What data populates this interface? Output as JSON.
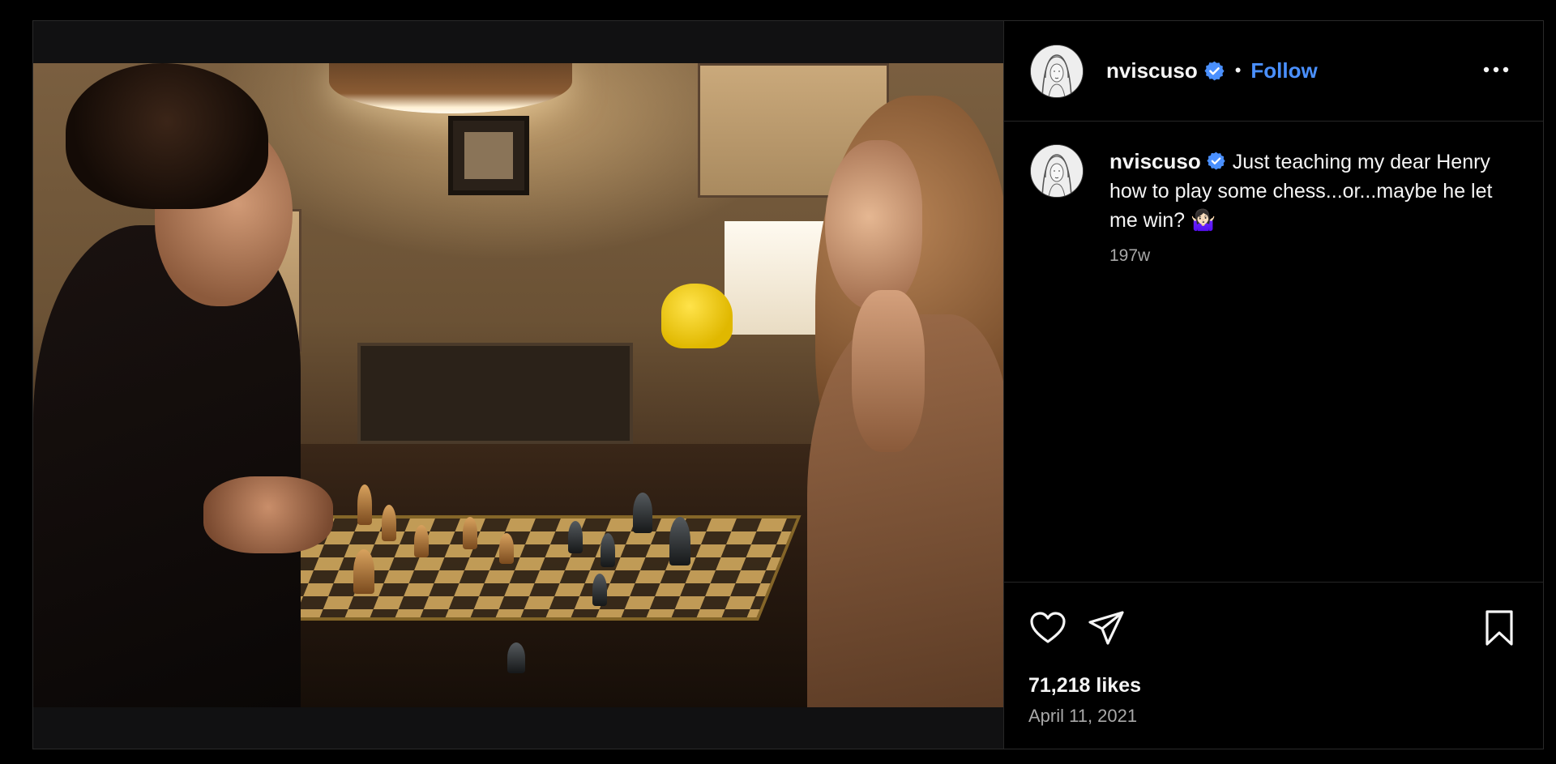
{
  "post": {
    "author": {
      "username": "nviscuso",
      "verified": true,
      "avatar_icon": "avatar-illustration"
    },
    "header": {
      "separator": "•",
      "follow_label": "Follow",
      "more_icon": "more-horizontal-icon"
    },
    "caption": {
      "username": "nviscuso",
      "text": "Just teaching my dear Henry how to play some chess...or...maybe he let me win? 🤷🏻‍♀️",
      "time_ago": "197w"
    },
    "actions": {
      "like_icon": "heart-icon",
      "share_icon": "paper-plane-icon",
      "save_icon": "bookmark-icon"
    },
    "likes_text": "71,218 likes",
    "date_text": "April 11, 2021"
  },
  "colors": {
    "background": "#000000",
    "text": "#f5f5f5",
    "secondary_text": "#a8a8a8",
    "accent": "#4a90ff",
    "verified_badge": "#4a90ff",
    "divider": "#262626"
  }
}
